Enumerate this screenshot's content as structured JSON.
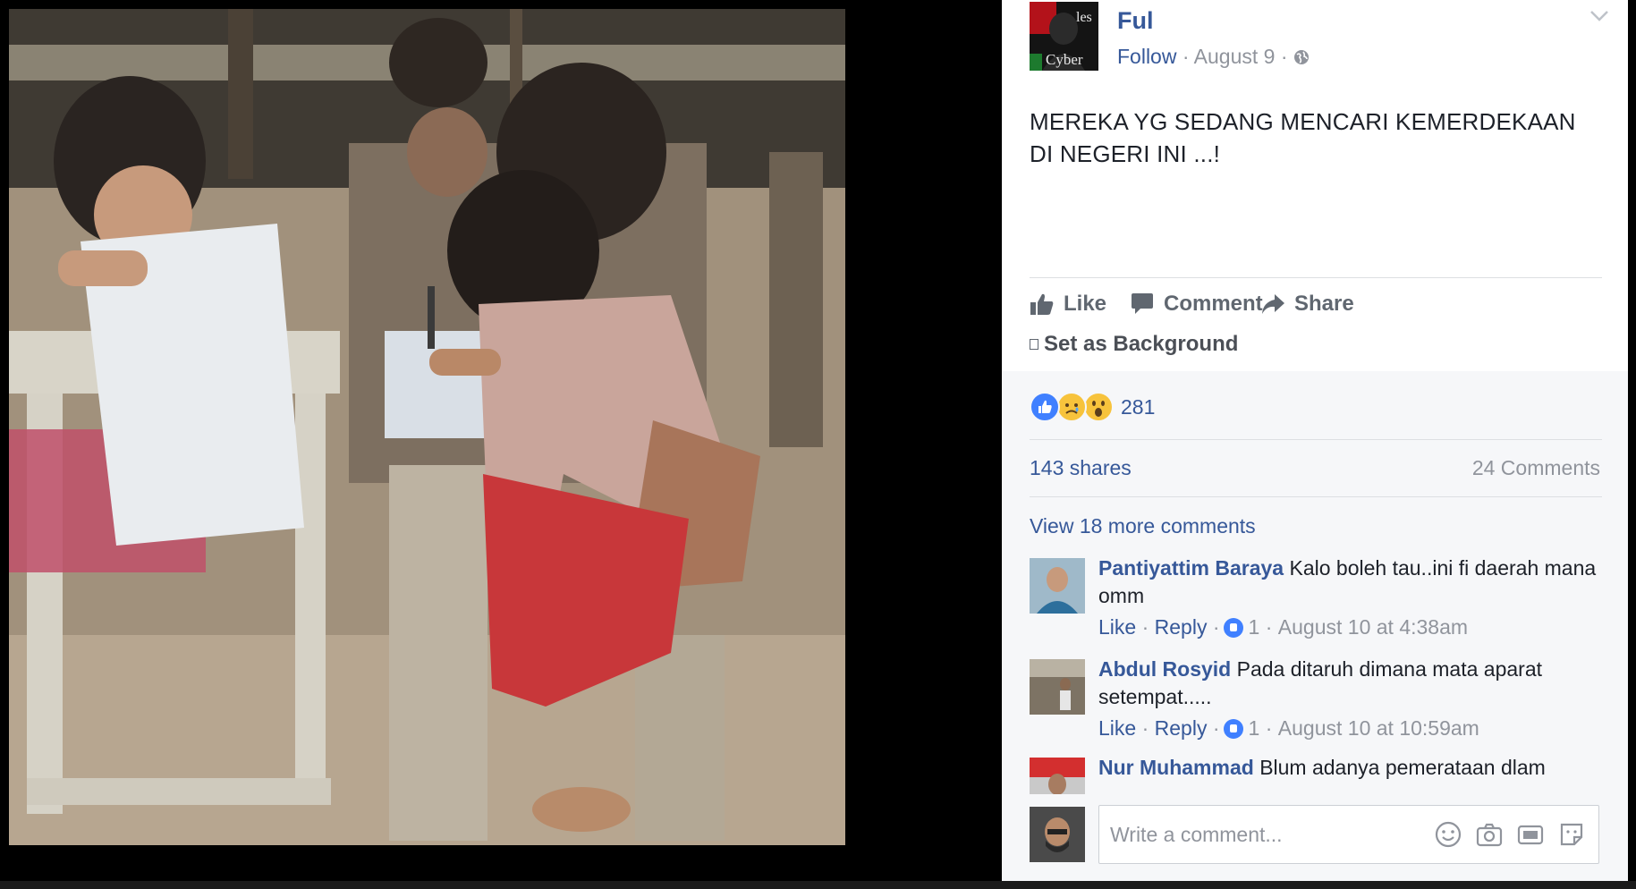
{
  "post": {
    "author": "Ful",
    "avatar_text_top": "les",
    "avatar_text_bottom": "Cyber",
    "follow_label": "Follow",
    "date": "August 9",
    "text_line1": "MEREKA YG SEDANG MENCARI KEMERDEKAAN",
    "text_line2": "DI NEGERI INI ...!"
  },
  "actions": {
    "like": "Like",
    "comment": "Comment",
    "share": "Share",
    "set_background": "Set as Background"
  },
  "stats": {
    "reaction_count": "281",
    "shares": "143 shares",
    "comments": "24 Comments",
    "reactions": [
      "like-icon",
      "sad-icon",
      "wow-icon"
    ]
  },
  "view_more": "View 18 more comments",
  "comments": [
    {
      "author": "Pantiyattim Baraya",
      "text": "Kalo boleh tau..ini fi daerah mana omm",
      "like": "Like",
      "reply": "Reply",
      "likes": "1",
      "time": "August 10 at 4:38am"
    },
    {
      "author": "Abdul Rosyid",
      "text": "Pada ditaruh dimana mata aparat setempat.....",
      "like": "Like",
      "reply": "Reply",
      "likes": "1",
      "time": "August 10 at 10:59am"
    },
    {
      "author": "Nur Muhammad",
      "text": "Blum adanya pemerataan dlam"
    }
  ],
  "write_comment": {
    "placeholder": "Write a comment..."
  },
  "colors": {
    "link": "#365899",
    "muted": "#90949c",
    "like_blue": "#4080ff",
    "reaction_yellow": "#f7c33c"
  }
}
